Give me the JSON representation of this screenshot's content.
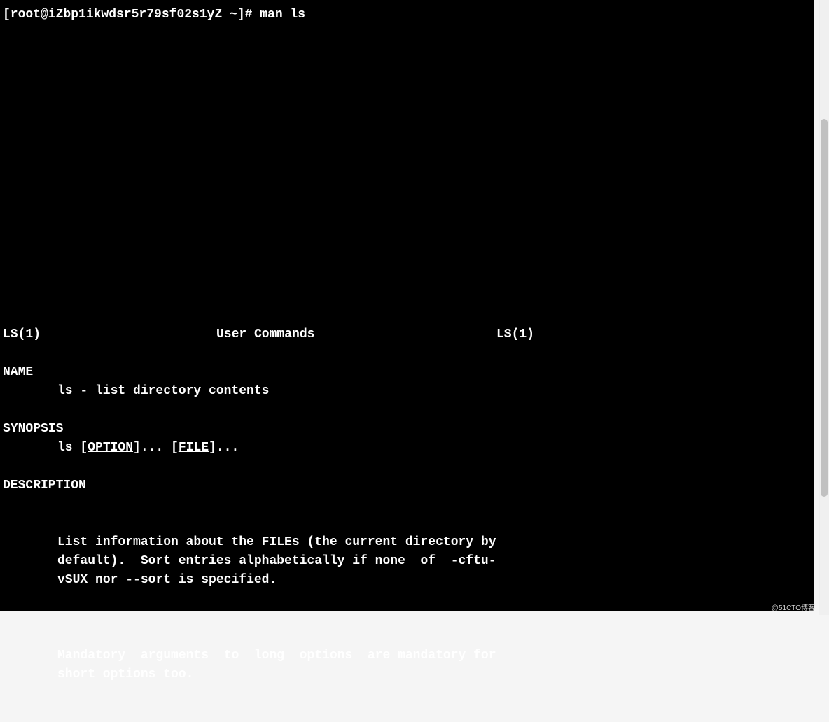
{
  "prompt": {
    "text": "[root@iZbp1ikwdsr5r79sf02s1yZ ~]# man ls"
  },
  "manpage": {
    "header": {
      "left": "LS(1)",
      "center": "User Commands",
      "right": "LS(1)"
    },
    "name": {
      "heading": "NAME",
      "content": "ls - list directory contents"
    },
    "synopsis": {
      "heading": "SYNOPSIS",
      "cmd": "ls",
      "open1": " [",
      "option": "OPTION",
      "close1": "]... [",
      "file": "FILE",
      "close2": "]..."
    },
    "description": {
      "heading": "DESCRIPTION",
      "para1_a": "List information about the FILEs (the current directory by\ndefault).  Sort entries alphabetically if none  of  ",
      "para1_b": "-cftu‐\nvSUX",
      "para1_c": " nor ",
      "para1_d": "--sort",
      "para1_e": " is specified.",
      "para2": "Mandatory  arguments  to  long  options  are mandatory for\nshort options too."
    }
  },
  "watermark": "@51CTO博客"
}
